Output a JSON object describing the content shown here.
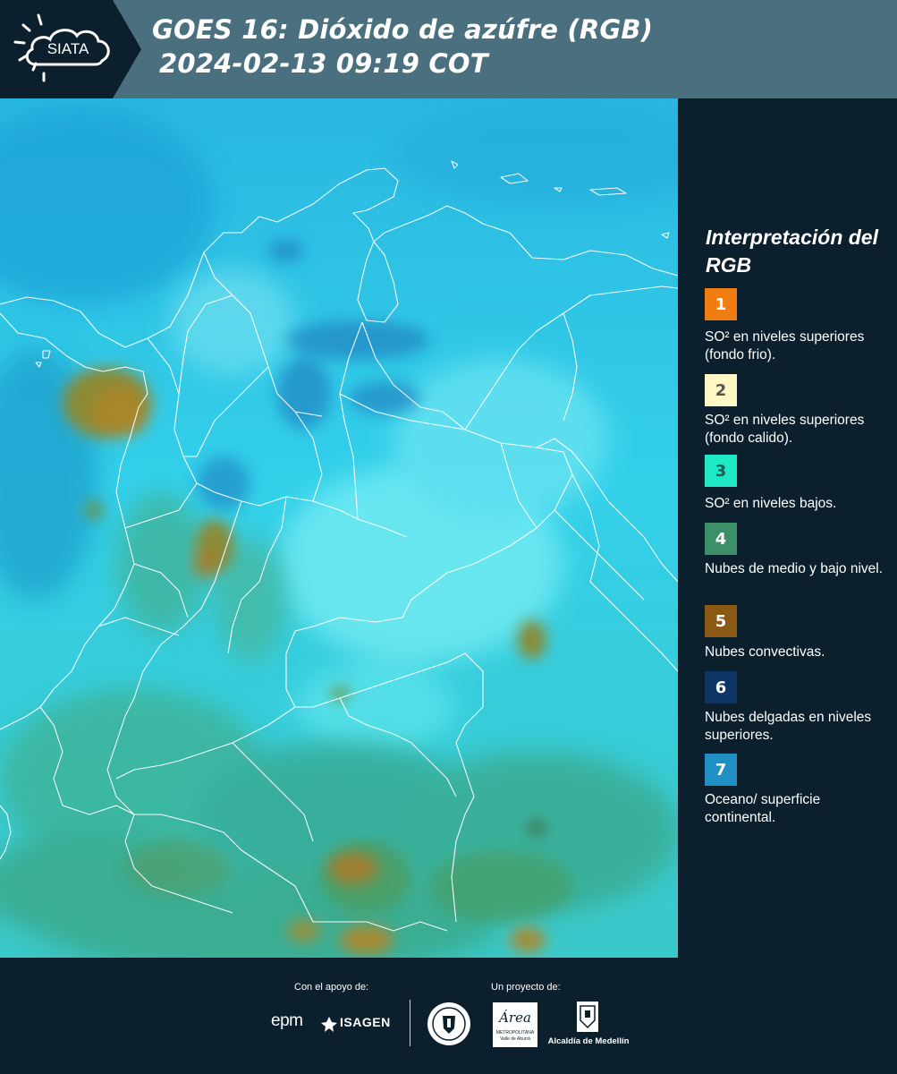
{
  "header": {
    "logo_text": "SIATA",
    "title_line1": "GOES 16: Dióxido de azúfre (RGB)",
    "title_line2": "2024-02-13 09:19 COT"
  },
  "legend": {
    "title": "Interpretación del RGB",
    "items": [
      {
        "number": "1",
        "label": "SO² en niveles superiores (fondo frio).",
        "color": "#f07d12",
        "text_color": "#ffffff"
      },
      {
        "number": "2",
        "label": "SO² en niveles superiores (fondo calido).",
        "color": "#fff7c4",
        "text_color": "#555555"
      },
      {
        "number": "3",
        "label": "SO² en niveles bajos.",
        "color": "#1de9c4",
        "text_color": "#2a5a55"
      },
      {
        "number": "4",
        "label": "Nubes de medio y bajo nivel.",
        "color": "#3c8f66",
        "text_color": "#ffffff"
      },
      {
        "number": "5",
        "label": "Nubes convectivas.",
        "color": "#8a5a14",
        "text_color": "#ffffff"
      },
      {
        "number": "6",
        "label": "Nubes delgadas en niveles superiores.",
        "color": "#0d3566",
        "text_color": "#ffffff"
      },
      {
        "number": "7",
        "label": "Oceano/ superficie continental.",
        "color": "#1f8fc4",
        "text_color": "#ffffff"
      }
    ]
  },
  "footer": {
    "support_label": "Con el apoyo de:",
    "project_label": "Un proyecto de:",
    "epm_text": "epm",
    "isagen_text": "ISAGEN",
    "area_text": "Área",
    "area_sub1": "METROPOLITANA",
    "area_sub2": "Valle de Aburrá",
    "medellin_text": "Alcaldía de Medellín"
  }
}
